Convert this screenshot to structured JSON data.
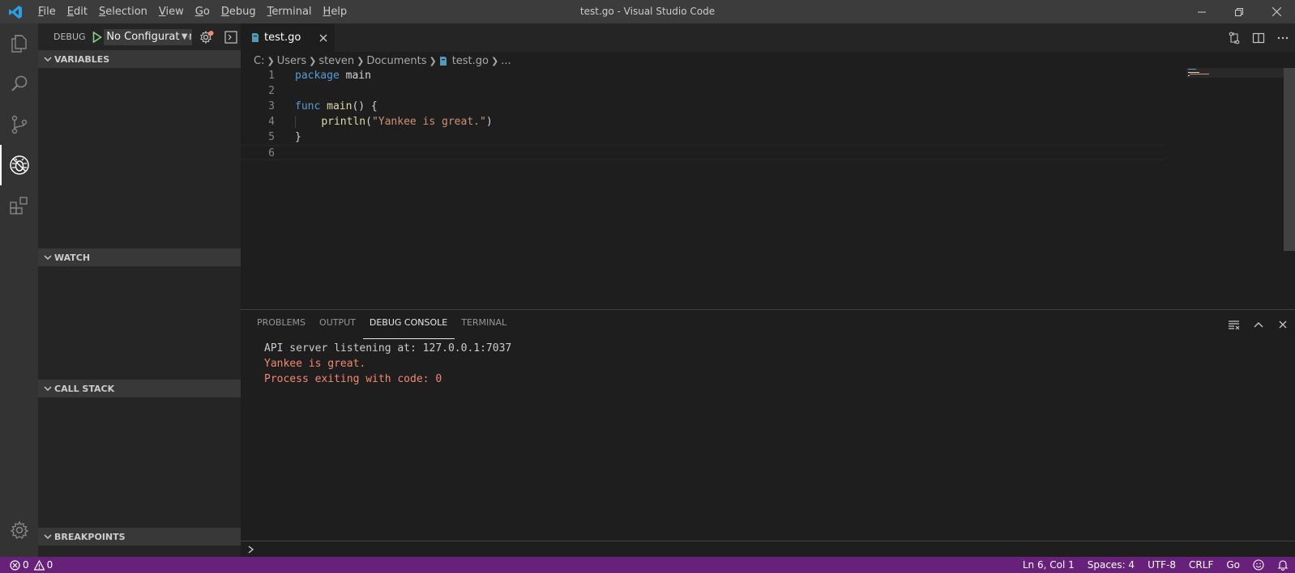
{
  "window": {
    "title": "test.go - Visual Studio Code"
  },
  "menu": [
    {
      "label": "File",
      "mnemonic": "F",
      "rest": "ile"
    },
    {
      "label": "Edit",
      "mnemonic": "E",
      "rest": "dit"
    },
    {
      "label": "Selection",
      "mnemonic": "S",
      "rest": "election"
    },
    {
      "label": "View",
      "mnemonic": "V",
      "rest": "iew"
    },
    {
      "label": "Go",
      "mnemonic": "G",
      "rest": "o"
    },
    {
      "label": "Debug",
      "mnemonic": "D",
      "rest": "ebug"
    },
    {
      "label": "Terminal",
      "mnemonic": "T",
      "rest": "erminal"
    },
    {
      "label": "Help",
      "mnemonic": "H",
      "rest": "elp"
    }
  ],
  "activity_bar": {
    "items": [
      "explorer-icon",
      "search-icon",
      "source-control-icon",
      "debug-icon",
      "extensions-icon"
    ],
    "active": "debug-icon",
    "bottom": "manage-gear-icon"
  },
  "sidebar": {
    "debug_label": "DEBUG",
    "configuration": "No Configurations",
    "sections": {
      "variables": "VARIABLES",
      "watch": "WATCH",
      "call_stack": "CALL STACK",
      "breakpoints": "BREAKPOINTS"
    }
  },
  "editor": {
    "tab": {
      "label": "test.go"
    },
    "breadcrumbs": [
      "C:",
      "Users",
      "steven",
      "Documents",
      "test.go",
      "..."
    ],
    "lines": [
      {
        "n": "1"
      },
      {
        "n": "2"
      },
      {
        "n": "3"
      },
      {
        "n": "4"
      },
      {
        "n": "5"
      },
      {
        "n": "6"
      }
    ],
    "code": {
      "l1_kw": "package",
      "l1_rest": " main",
      "l3_kw": "func",
      "l3_fn": "main",
      "l3_rest": "() {",
      "l4_indent": "    ",
      "l4_fn": "println",
      "l4_open": "(",
      "l4_str": "\"Yankee is great.\"",
      "l4_close": ")",
      "l5": "}"
    }
  },
  "panel": {
    "tabs": [
      "PROBLEMS",
      "OUTPUT",
      "DEBUG CONSOLE",
      "TERMINAL"
    ],
    "active_tab": "DEBUG CONSOLE",
    "console": [
      {
        "text": "API server listening at: 127.0.0.1:7037",
        "kind": "stdout"
      },
      {
        "text": "Yankee is great.",
        "kind": "stderr"
      },
      {
        "text": "Process exiting with code: 0",
        "kind": "stderr"
      }
    ]
  },
  "statusbar": {
    "errors": "0",
    "warnings": "0",
    "position": "Ln 6, Col 1",
    "spaces": "Spaces: 4",
    "encoding": "UTF-8",
    "eol": "CRLF",
    "language": "Go",
    "color": "#68217a"
  },
  "colors": {
    "keyword": "#569cd6",
    "function": "#dcdcaa",
    "string": "#ce9178",
    "console_error": "#f48771",
    "accent": "#007acc"
  }
}
